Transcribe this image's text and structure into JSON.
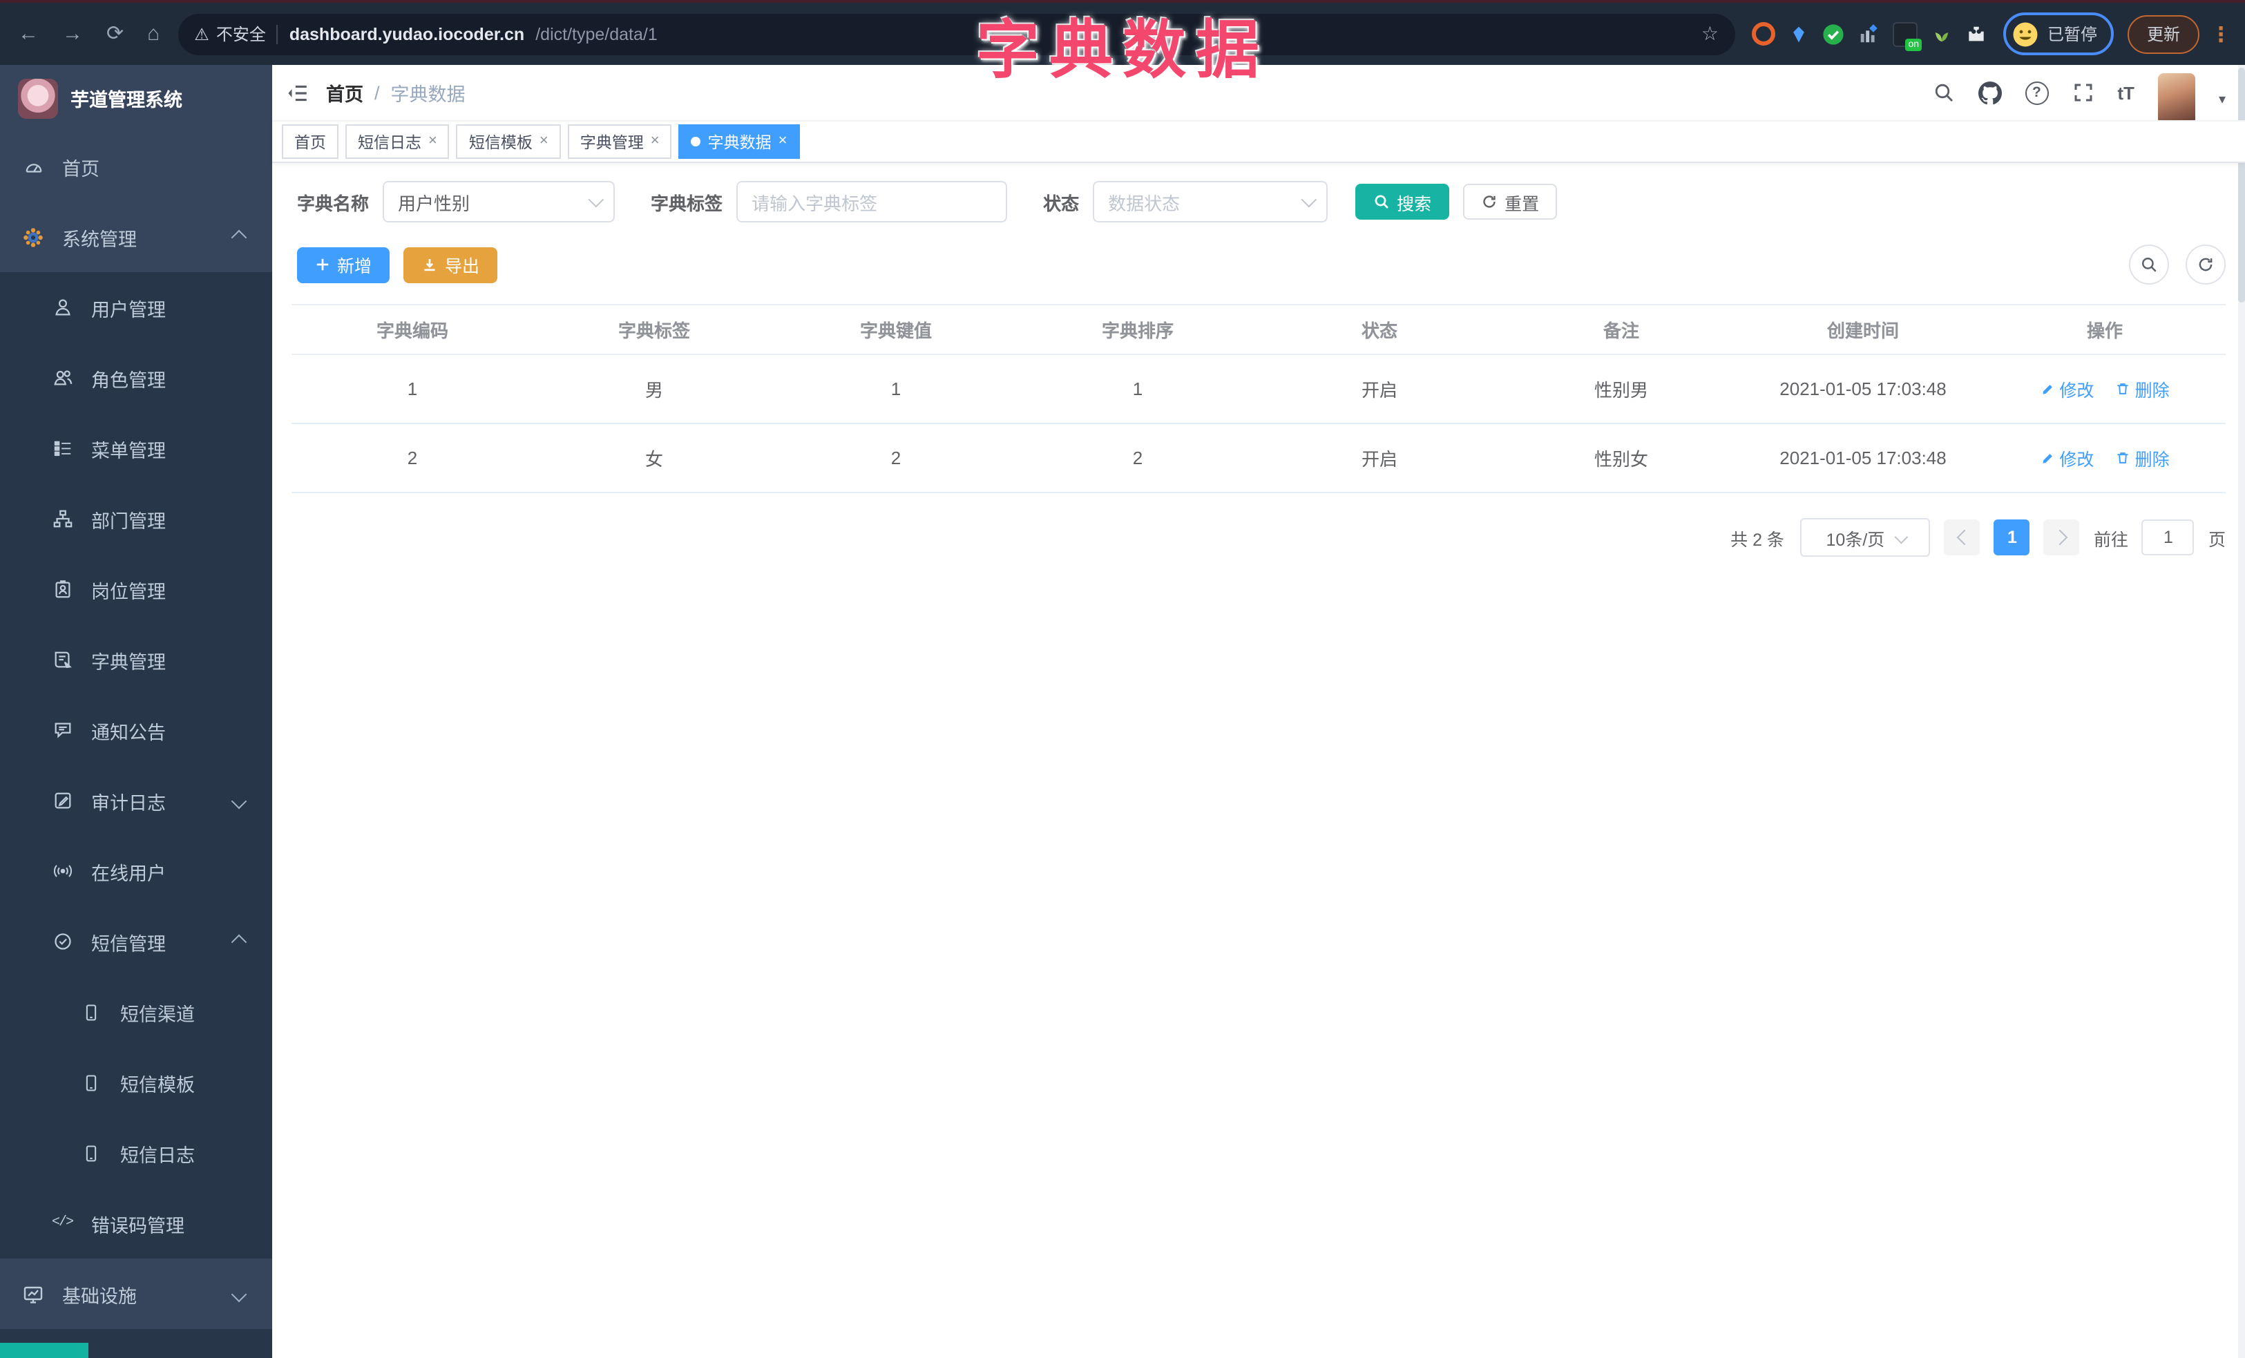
{
  "browser": {
    "warning": "不安全",
    "host": "dashboard.yudao.iocoder.cn",
    "path": "/dict/type/data/1",
    "on_badge": "on",
    "paused": "已暂停",
    "update": "更新"
  },
  "annotation": {
    "text": "字典数据",
    "color": "#f3476d"
  },
  "sidebar": {
    "title": "芋道管理系统",
    "menu": [
      {
        "label": "首页"
      },
      {
        "label": "系统管理"
      },
      {
        "label": "用户管理"
      },
      {
        "label": "角色管理"
      },
      {
        "label": "菜单管理"
      },
      {
        "label": "部门管理"
      },
      {
        "label": "岗位管理"
      },
      {
        "label": "字典管理"
      },
      {
        "label": "通知公告"
      },
      {
        "label": "审计日志"
      },
      {
        "label": "在线用户"
      },
      {
        "label": "短信管理"
      },
      {
        "label": "短信渠道"
      },
      {
        "label": "短信模板"
      },
      {
        "label": "短信日志"
      },
      {
        "label": "错误码管理"
      },
      {
        "label": "基础设施"
      }
    ]
  },
  "navbar": {
    "breadcrumb_home": "首页",
    "breadcrumb_sep": "/",
    "breadcrumb_current": "字典数据",
    "font_size_icon": "tT"
  },
  "tags": [
    {
      "label": "首页",
      "closable": false,
      "active": false
    },
    {
      "label": "短信日志",
      "closable": true,
      "active": false
    },
    {
      "label": "短信模板",
      "closable": true,
      "active": false
    },
    {
      "label": "字典管理",
      "closable": true,
      "active": false
    },
    {
      "label": "字典数据",
      "closable": true,
      "active": true
    }
  ],
  "filter": {
    "name_label": "字典名称",
    "name_value": "用户性别",
    "tag_label": "字典标签",
    "tag_placeholder": "请输入字典标签",
    "status_label": "状态",
    "status_placeholder": "数据状态",
    "search": "搜索",
    "reset": "重置"
  },
  "toolbar": {
    "add": "新增",
    "export": "导出"
  },
  "table": {
    "columns": [
      "字典编码",
      "字典标签",
      "字典键值",
      "字典排序",
      "状态",
      "备注",
      "创建时间",
      "操作"
    ],
    "rows": [
      [
        "1",
        "男",
        "1",
        "1",
        "开启",
        "性别男",
        "2021-01-05 17:03:48"
      ],
      [
        "2",
        "女",
        "2",
        "2",
        "开启",
        "性别女",
        "2021-01-05 17:03:48"
      ]
    ],
    "op_edit": "修改",
    "op_delete": "删除"
  },
  "pagination": {
    "total": "共 2 条",
    "size": "10条/页",
    "page": "1",
    "goto": "前往",
    "goto_value": "1",
    "unit": "页"
  },
  "colors": {
    "primary": "#409EFF",
    "warning": "#E6A23C",
    "search_teal": "#17b3a3",
    "sidebar_dark": "#273649",
    "sidebar_light": "#36455b",
    "chrome": "#212c3b"
  }
}
